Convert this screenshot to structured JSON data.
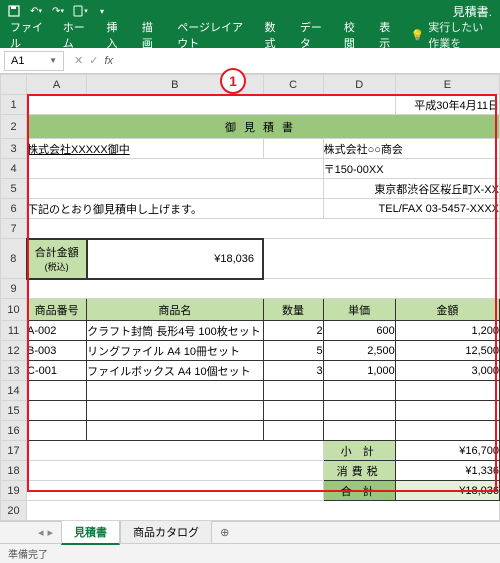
{
  "titlebar": {
    "doc": "見積書."
  },
  "ribbon": {
    "tabs": [
      "ファイル",
      "ホーム",
      "挿入",
      "描画",
      "ページレイアウト",
      "数式",
      "データ",
      "校閲",
      "表示"
    ],
    "tellme": "実行したい作業を"
  },
  "namebox": "A1",
  "annotation": "1",
  "cols": [
    "A",
    "B",
    "C",
    "D",
    "E"
  ],
  "sheet": {
    "date": "平成30年4月11日",
    "title": "御見積書",
    "customer": "株式会社XXXXX御中",
    "vendor_name": "株式会社○○商会",
    "vendor_postal": "〒150-00XX",
    "vendor_addr": "東京都渋谷区桜丘町X-XX",
    "vendor_tel": "TEL/FAX 03-5457-XXXX",
    "note": "下記のとおり御見積申し上げます。",
    "total_label": "合計金額",
    "total_sub": "(税込)",
    "total_val": "¥18,036",
    "hdr": {
      "no": "商品番号",
      "name": "商品名",
      "qty": "数量",
      "price": "単価",
      "amt": "金額"
    },
    "rows": [
      {
        "no": "A-002",
        "name": "クラフト封筒 長形4号 100枚セット",
        "qty": "2",
        "price": "600",
        "amt": "1,200"
      },
      {
        "no": "B-003",
        "name": "リングファイル A4 10冊セット",
        "qty": "5",
        "price": "2,500",
        "amt": "12,500"
      },
      {
        "no": "C-001",
        "name": "ファイルボックス A4 10個セット",
        "qty": "3",
        "price": "1,000",
        "amt": "3,000"
      }
    ],
    "subtotal_l": "小 計",
    "subtotal": "¥16,700",
    "tax_l": "消費税",
    "tax": "¥1,336",
    "grand_l": "合 計",
    "grand": "¥18,036"
  },
  "tabs": {
    "active": "見積書",
    "other": "商品カタログ"
  },
  "status": "準備完了"
}
